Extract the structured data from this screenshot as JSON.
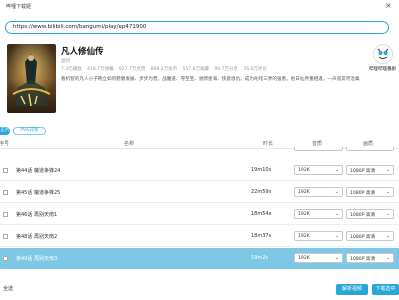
{
  "window": {
    "title": "哔哩下载姬",
    "close_glyph": "×"
  },
  "url_input": {
    "value": "https://www.bilibili.com/bangumi/play/ep471900"
  },
  "video": {
    "title": "凡人修仙传",
    "subtitle": "国创",
    "stats": [
      "7.3亿播放",
      "418.7万弹幕",
      "927.7万点赞",
      "899.2万投币",
      "557.8万收藏",
      "99.7万分享",
      "76.0万评论"
    ],
    "description": "看机智的凡人小子韩立如何稳健发展、步步为营，战魔道、夺至宝、驰骋星海、快意恩仇，成为叱咤三界的强者。他日仙界重相逢，一声道友尽沧桑"
  },
  "uploader": {
    "name": "哔哩哔哩番剧"
  },
  "tags": [
    "正片",
    "PV&花絮"
  ],
  "table": {
    "headers": {
      "number": "序号",
      "name": "名称",
      "duration": "时长",
      "audio": "音质",
      "video": "画质"
    },
    "rows": [
      {
        "name": "第44话 魔道争锋24",
        "duration": "19m10s",
        "audio": "192K",
        "video": "1080P 高清",
        "selected": false
      },
      {
        "name": "第45话 魔道争锋25",
        "duration": "22m59s",
        "audio": "192K",
        "video": "1080P 高清",
        "selected": false
      },
      {
        "name": "第46话 再别天南1",
        "duration": "18m54s",
        "audio": "192K",
        "video": "1080P 高清",
        "selected": false
      },
      {
        "name": "第48话 再别天南2",
        "duration": "18m37s",
        "audio": "192K",
        "video": "1080P 高清",
        "selected": false
      },
      {
        "name": "第49话 再别天南3",
        "duration": "19m2s",
        "audio": "192K",
        "video": "1080P 高清",
        "selected": true
      }
    ]
  },
  "bottom": {
    "hint": "全选",
    "parse_label": "解析视频",
    "download_label": "下载选中"
  },
  "icons": {
    "dropdown": "chevron-down-icon"
  },
  "colors": {
    "accent": "#2aa7d8",
    "selected_row": "#7ec8e6"
  }
}
